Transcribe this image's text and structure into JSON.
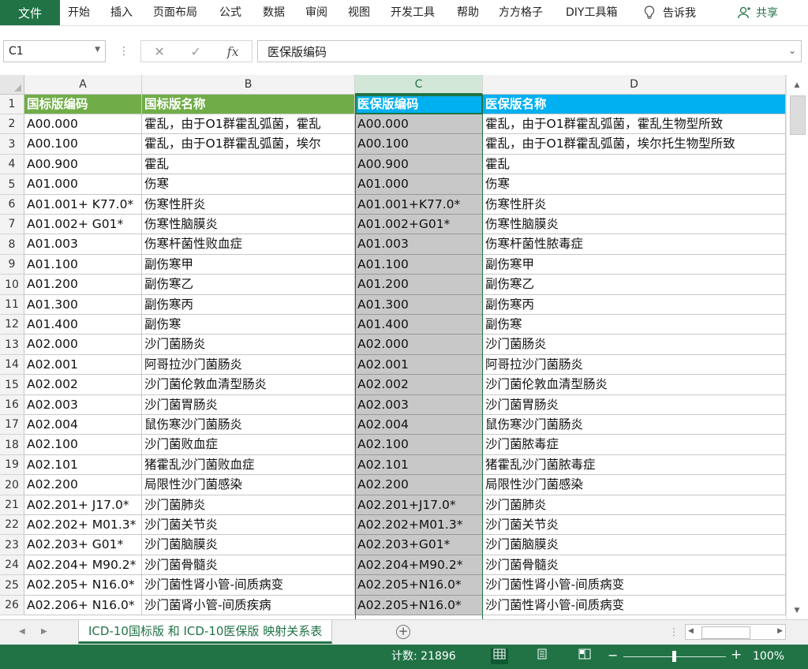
{
  "ribbon": {
    "file": "文件",
    "tabs": [
      "开始",
      "插入",
      "页面布局",
      "公式",
      "数据",
      "审阅",
      "视图",
      "开发工具",
      "帮助",
      "方方格子",
      "DIY工具箱"
    ],
    "tell_me": "告诉我",
    "share": "共享",
    "icons": {
      "tell_me": "lightbulb-icon",
      "share": "person-icon"
    }
  },
  "formula_bar": {
    "name_box": "C1",
    "formula": "医保版编码",
    "icons": [
      "cancel-icon",
      "confirm-icon",
      "fx-icon"
    ]
  },
  "columns": [
    "A",
    "B",
    "C",
    "D"
  ],
  "selected_column": "C",
  "headers": {
    "a": "国标版编码",
    "b": "国标版名称",
    "c": "医保版编码",
    "d": "医保版名称"
  },
  "header_colors": {
    "national": "#70ad47",
    "insurance": "#00b0f0"
  },
  "rows": [
    {
      "n": "2",
      "a": "A00.000",
      "b": "霍乱，由于O1群霍乱弧菌，霍乱",
      "c": "A00.000",
      "d": "霍乱，由于O1群霍乱弧菌，霍乱生物型所致"
    },
    {
      "n": "3",
      "a": "A00.100",
      "b": "霍乱，由于O1群霍乱弧菌，埃尔",
      "c": "A00.100",
      "d": "霍乱，由于O1群霍乱弧菌，埃尔托生物型所致"
    },
    {
      "n": "4",
      "a": "A00.900",
      "b": "霍乱",
      "c": "A00.900",
      "d": "霍乱"
    },
    {
      "n": "5",
      "a": "A01.000",
      "b": "伤寒",
      "c": "A01.000",
      "d": "伤寒"
    },
    {
      "n": "6",
      "a": "A01.001+ K77.0*",
      "b": "伤寒性肝炎",
      "c": "A01.001+K77.0*",
      "d": "伤寒性肝炎"
    },
    {
      "n": "7",
      "a": "A01.002+ G01*",
      "b": "伤寒性脑膜炎",
      "c": "A01.002+G01*",
      "d": "伤寒性脑膜炎"
    },
    {
      "n": "8",
      "a": "A01.003",
      "b": "伤寒杆菌性败血症",
      "c": "A01.003",
      "d": "伤寒杆菌性脓毒症"
    },
    {
      "n": "9",
      "a": "A01.100",
      "b": "副伤寒甲",
      "c": "A01.100",
      "d": "副伤寒甲"
    },
    {
      "n": "10",
      "a": "A01.200",
      "b": "副伤寒乙",
      "c": "A01.200",
      "d": "副伤寒乙"
    },
    {
      "n": "11",
      "a": "A01.300",
      "b": "副伤寒丙",
      "c": "A01.300",
      "d": "副伤寒丙"
    },
    {
      "n": "12",
      "a": "A01.400",
      "b": "副伤寒",
      "c": "A01.400",
      "d": "副伤寒"
    },
    {
      "n": "13",
      "a": "A02.000",
      "b": "沙门菌肠炎",
      "c": "A02.000",
      "d": "沙门菌肠炎"
    },
    {
      "n": "14",
      "a": "A02.001",
      "b": "阿哥拉沙门菌肠炎",
      "c": "A02.001",
      "d": "阿哥拉沙门菌肠炎"
    },
    {
      "n": "15",
      "a": "A02.002",
      "b": "沙门菌伦敦血清型肠炎",
      "c": "A02.002",
      "d": "沙门菌伦敦血清型肠炎"
    },
    {
      "n": "16",
      "a": "A02.003",
      "b": "沙门菌胃肠炎",
      "c": "A02.003",
      "d": "沙门菌胃肠炎"
    },
    {
      "n": "17",
      "a": "A02.004",
      "b": "鼠伤寒沙门菌肠炎",
      "c": "A02.004",
      "d": "鼠伤寒沙门菌肠炎"
    },
    {
      "n": "18",
      "a": "A02.100",
      "b": "沙门菌败血症",
      "c": "A02.100",
      "d": "沙门菌脓毒症"
    },
    {
      "n": "19",
      "a": "A02.101",
      "b": "猪霍乱沙门菌败血症",
      "c": "A02.101",
      "d": "猪霍乱沙门菌脓毒症"
    },
    {
      "n": "20",
      "a": "A02.200",
      "b": "局限性沙门菌感染",
      "c": "A02.200",
      "d": "局限性沙门菌感染"
    },
    {
      "n": "21",
      "a": "A02.201+ J17.0*",
      "b": "沙门菌肺炎",
      "c": "A02.201+J17.0*",
      "d": "沙门菌肺炎"
    },
    {
      "n": "22",
      "a": "A02.202+ M01.3*",
      "b": "沙门菌关节炎",
      "c": "A02.202+M01.3*",
      "d": "沙门菌关节炎"
    },
    {
      "n": "23",
      "a": "A02.203+ G01*",
      "b": "沙门菌脑膜炎",
      "c": "A02.203+G01*",
      "d": "沙门菌脑膜炎"
    },
    {
      "n": "24",
      "a": "A02.204+ M90.2*",
      "b": "沙门菌骨髓炎",
      "c": "A02.204+M90.2*",
      "d": "沙门菌骨髓炎"
    },
    {
      "n": "25",
      "a": "A02.205+ N16.0*",
      "b": "沙门菌性肾小管-间质病变",
      "c": "A02.205+N16.0*",
      "d": "沙门菌性肾小管-间质病变"
    },
    {
      "n": "26",
      "a": "A02.206+ N16.0*",
      "b": "沙门菌肾小管-间质疾病",
      "c": "A02.205+N16.0*",
      "d": "沙门菌性肾小管-间质病变"
    }
  ],
  "sheet_tab": "ICD-10国标版 和 ICD-10医保版 映射关系表",
  "status": {
    "count": "计数: 21896",
    "zoom": "100%",
    "zoom_level_percent": 100,
    "view_icons": [
      "normal-view-icon",
      "page-layout-icon",
      "page-break-icon"
    ]
  }
}
